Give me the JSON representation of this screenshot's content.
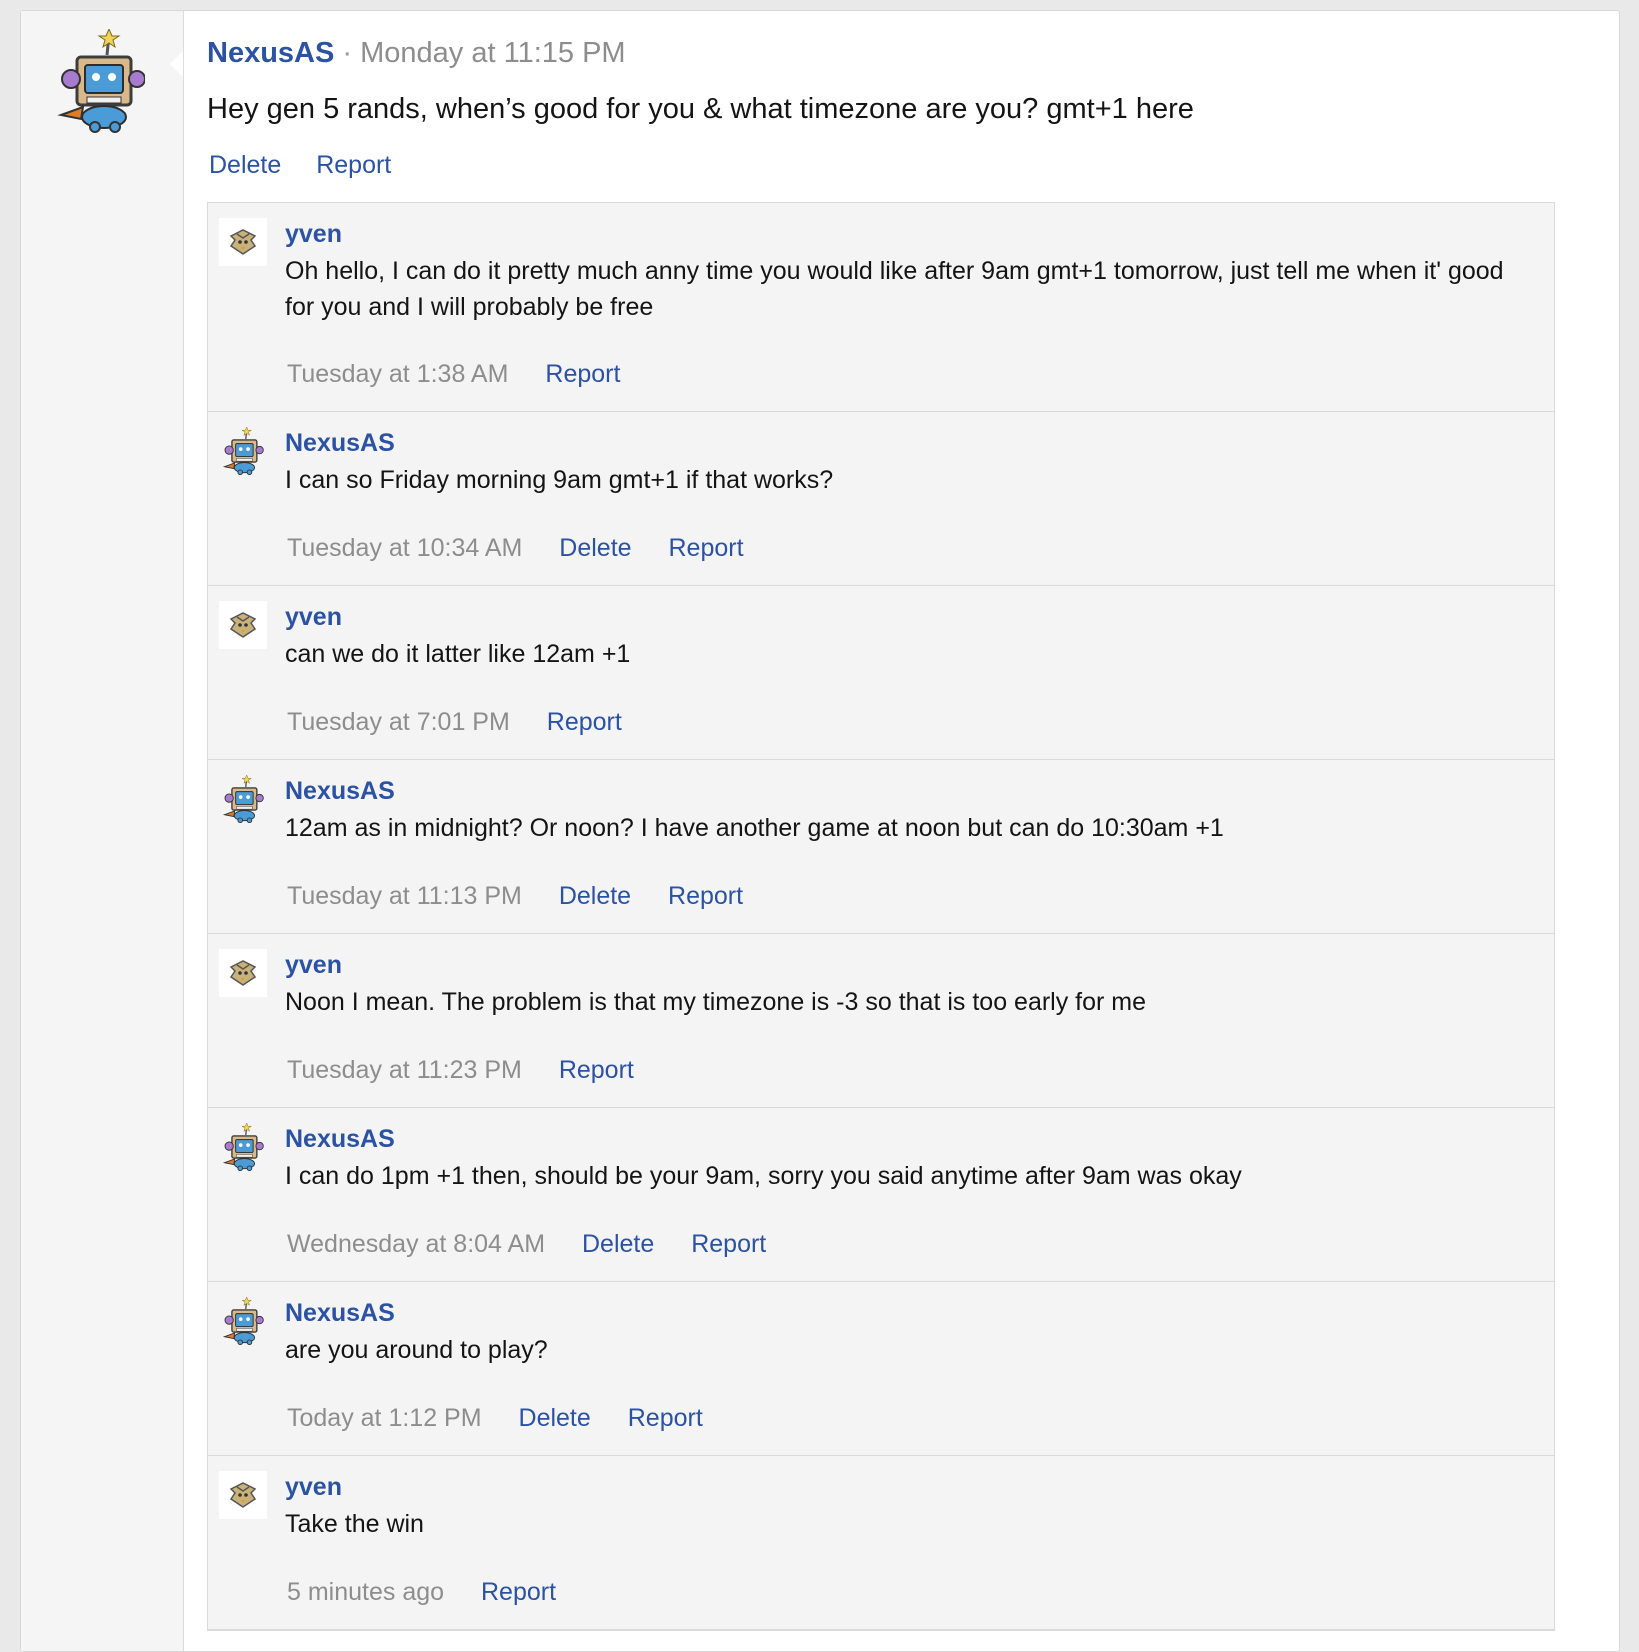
{
  "colors": {
    "link": "#2b52a3",
    "meta": "#8d8d8d",
    "comment_bg": "#f4f4f4",
    "sidebar_bg": "#f5f5f5"
  },
  "post": {
    "author": "NexusAS",
    "separator": "·",
    "time": "Monday at 11:15 PM",
    "text": "Hey gen 5 rands, when’s good for you & what timezone are you? gmt+1 here",
    "avatar_icon": "robot-mascot-avatar",
    "actions": {
      "delete": "Delete",
      "report": "Report"
    }
  },
  "comments": [
    {
      "author": "yven",
      "avatar_icon": "bird-avatar",
      "text": "Oh hello, I can do it pretty much anny time you would like after 9am gmt+1 tomorrow, just tell me when it' good for you and I will probably be free",
      "time": "Tuesday at 1:38 AM",
      "delete": "",
      "report": "Report"
    },
    {
      "author": "NexusAS",
      "avatar_icon": "robot-mascot-avatar",
      "text": "I can so Friday morning 9am gmt+1 if that works?",
      "time": "Tuesday at 10:34 AM",
      "delete": "Delete",
      "report": "Report"
    },
    {
      "author": "yven",
      "avatar_icon": "bird-avatar",
      "text": "can we do it latter like 12am +1",
      "time": "Tuesday at 7:01 PM",
      "delete": "",
      "report": "Report"
    },
    {
      "author": "NexusAS",
      "avatar_icon": "robot-mascot-avatar",
      "text": "12am as in midnight? Or noon? I have another game at noon but can do 10:30am +1",
      "time": "Tuesday at 11:13 PM",
      "delete": "Delete",
      "report": "Report"
    },
    {
      "author": "yven",
      "avatar_icon": "bird-avatar",
      "text": "Noon I mean. The problem is that my timezone is -3 so that is too early for me",
      "time": "Tuesday at 11:23 PM",
      "delete": "",
      "report": "Report"
    },
    {
      "author": "NexusAS",
      "avatar_icon": "robot-mascot-avatar",
      "text": "I can do 1pm +1 then, should be your 9am, sorry you said anytime after 9am was okay",
      "time": "Wednesday at 8:04 AM",
      "delete": "Delete",
      "report": "Report"
    },
    {
      "author": "NexusAS",
      "avatar_icon": "robot-mascot-avatar",
      "text": "are you around to play?",
      "time": "Today at 1:12 PM",
      "delete": "Delete",
      "report": "Report"
    },
    {
      "author": "yven",
      "avatar_icon": "bird-avatar",
      "text": "Take the win",
      "time": "5 minutes ago",
      "delete": "",
      "report": "Report"
    }
  ]
}
